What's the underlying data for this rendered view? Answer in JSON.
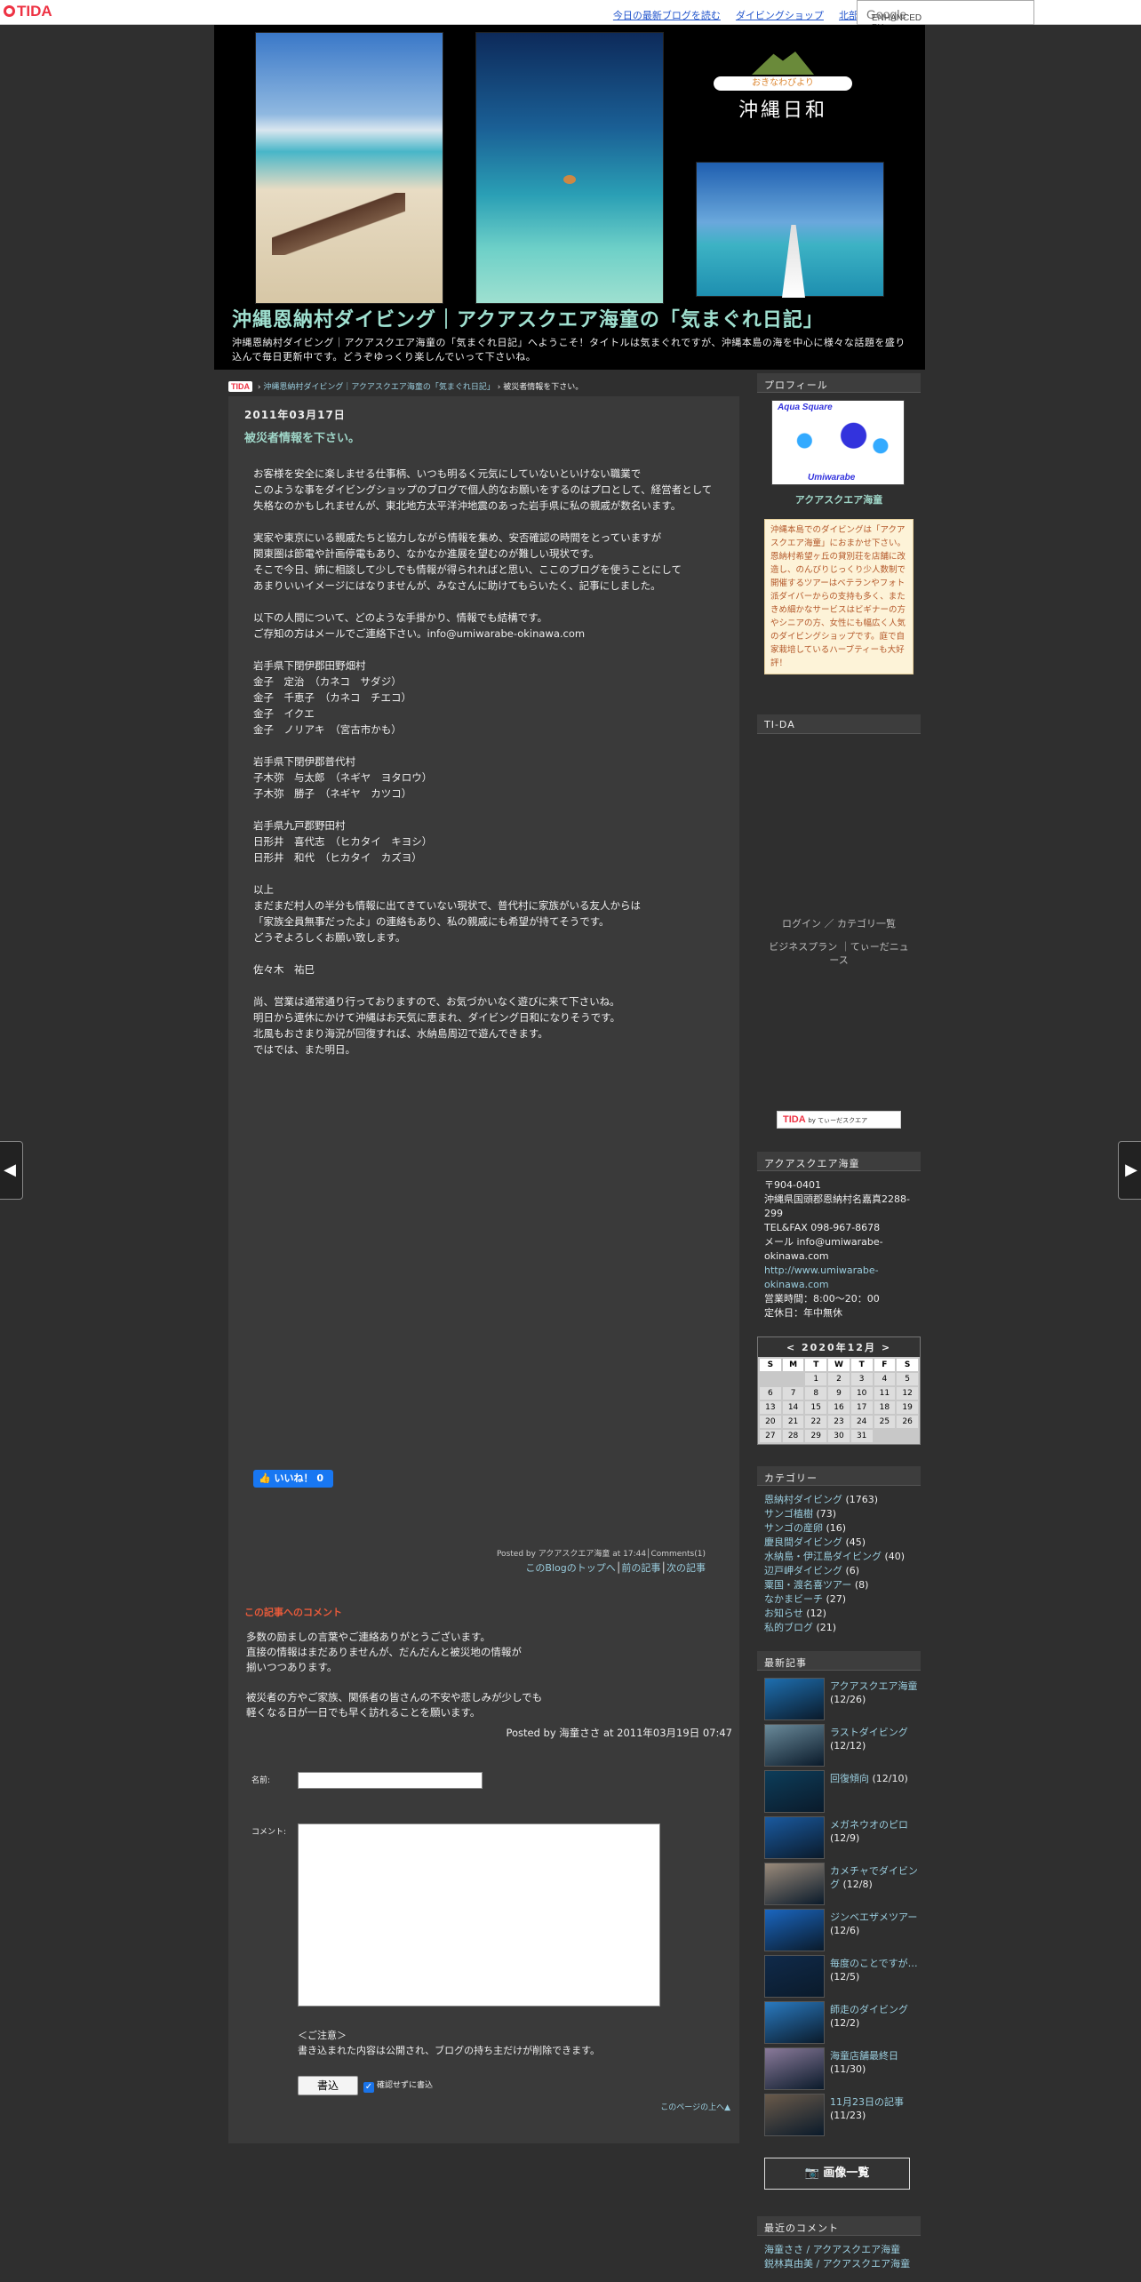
{
  "topbar": {
    "logo": "TIDA",
    "links": [
      "今日の最新ブログを読む",
      "ダイビングショップ",
      "北部"
    ],
    "search_label": "ENHANCED BY",
    "search_brand": "Google"
  },
  "header": {
    "logo_pill": "おきなわびより",
    "logo_name": "沖縄日和",
    "title": "沖縄恩納村ダイビング｜アクアスクエア海童の「気まぐれ日記」",
    "description": "沖縄恩納村ダイビング｜アクアスクエア海童の「気まぐれ日記」へようこそ！タイトルは気まぐれですが、沖縄本島の海を中心に様々な話題を盛り込んで毎日更新中です。どうぞゆっくり楽しんでいって下さいね。"
  },
  "breadcrumb": {
    "logo": "TIDA",
    "sep1": "›",
    "blog": "沖縄恩納村ダイビング｜アクアスクエア海童の「気まぐれ日記」",
    "sep2": "›",
    "current": "被災者情報を下さい。"
  },
  "post": {
    "date": "2011年03月17日",
    "title": "被災者情報を下さい。",
    "lines": [
      "お客様を安全に楽しませる仕事柄、いつも明るく元気にしていないといけない職業で",
      "このような事をダイビングショップのブログで個人的なお願いをするのはプロとして、経営者として",
      "失格なのかもしれませんが、東北地方太平洋沖地震のあった岩手県に私の親戚が数名います。",
      "",
      "実家や東京にいる親戚たちと協力しながら情報を集め、安否確認の時間をとっていますが",
      "関東圏は節電や計画停電もあり、なかなか進展を望むのが難しい現状です。",
      "そこで今日、姉に相談して少しでも情報が得られればと思い、ここのブログを使うことにして",
      "あまりいいイメージにはなりませんが、みなさんに助けてもらいたく、記事にしました。",
      "",
      "以下の人間について、どのような手掛かり、情報でも結構です。",
      "ご存知の方はメールでご連絡下さい。info@umiwarabe-okinawa.com",
      "",
      "岩手県下閉伊郡田野畑村",
      "金子　定治　（カネコ　サダジ）",
      "金子　千恵子　（カネコ　チエコ）",
      "金子　イクエ",
      "金子　ノリアキ　（宮古市かも）",
      "",
      "岩手県下閉伊郡普代村",
      "子木弥　与太郎　（ネギヤ　ヨタロウ）",
      "子木弥　勝子　（ネギヤ　カツコ）",
      "",
      "岩手県九戸郡野田村",
      "日形井　喜代志　（ヒカタイ　キヨシ）",
      "日形井　和代　（ヒカタイ　カズヨ）",
      "",
      "以上",
      "まだまだ村人の半分も情報に出てきていない現状で、普代村に家族がいる友人からは",
      "「家族全員無事だったよ」の連絡もあり、私の親戚にも希望が持てそうです。",
      "どうぞよろしくお願い致します。",
      "",
      "佐々木　祐巳",
      "",
      "尚、営業は通常通り行っておりますので、お気づかいなく遊びに来て下さいね。",
      "明日から連休にかけて沖縄はお天気に恵まれ、ダイビング日和になりそうです。",
      "北風もおさまり海況が回復すれば、水納島周辺で遊んできます。",
      "ではでは、また明日。"
    ],
    "like_label": "いいね！ 0",
    "posted_by": "Posted by アクアスクエア海童 at 17:44│Comments(1)",
    "nav_top": "このBlogのトップへ",
    "nav_prev": "前の記事",
    "nav_next": "次の記事"
  },
  "comments": {
    "heading": "この記事へのコメント",
    "lines": [
      "多数の励ましの言葉やご連絡ありがとうございます。",
      "直接の情報はまだありませんが、だんだんと被災地の情報が",
      "揃いつつあります。",
      "",
      "被災者の方やご家族、関係者の皆さんの不安や悲しみが少しでも",
      "軽くなる日が一日でも早く訪れることを願います。"
    ],
    "meta": "Posted by 海童ささ at 2011年03月19日 07:47",
    "name_label": "名前:",
    "comment_label": "コメント:",
    "notice_title": "＜ご注意＞",
    "notice_text": "書き込まれた内容は公開され、ブログの持ち主だけが削除できます。",
    "submit": "書込",
    "confirm_label": "確認せずに書込",
    "page_top": "このページの上へ▲"
  },
  "sidebar": {
    "profile_head": "プロフィール",
    "profile_logo_top": "Aqua Square",
    "profile_logo_bottom": "Umiwarabe",
    "profile_name": "アクアスクエア海童",
    "profile_text": "沖縄本島でのダイビングは「アクアスクエア海童」におまかせ下さい。恩納村希望ヶ丘の貸別荘を店舗に改造し、のんびりじっくり少人数制で開催するツアーはベテランやフォト派ダイバーからの支持も多く、またきめ細かなサービスはビギナーの方やシニアの方、女性にも幅広く人気のダイビングショップです。庭で自家栽培しているハーブティーも大好評！",
    "tida_head": "TI-DA",
    "tida_links": [
      "ログイン ／ カテゴリ一覧",
      "ビジネスプラン ｜てぃーだニュース"
    ],
    "tida_badge": "TIDA",
    "tida_badge_small": "by てぃーだスクエア",
    "shop_head": "アクアスクエア海童",
    "shop_lines": [
      "〒904-0401",
      "沖縄県国頭郡恩納村名嘉真2288-299",
      "TEL&FAX 098-967-8678",
      "メール info@umiwarabe-okinawa.com"
    ],
    "shop_url": "http://www.umiwarabe-okinawa.com",
    "shop_lines2": [
      "営業時間：8:00～20：00",
      "定休日：年中無休"
    ],
    "calendar": {
      "prev": "<",
      "title": "2020年12月",
      "next": ">",
      "weekdays": [
        "S",
        "M",
        "T",
        "W",
        "T",
        "F",
        "S"
      ],
      "weeks": [
        [
          "",
          "",
          "1",
          "2",
          "3",
          "4",
          "5"
        ],
        [
          "6",
          "7",
          "8",
          "9",
          "10",
          "11",
          "12"
        ],
        [
          "13",
          "14",
          "15",
          "16",
          "17",
          "18",
          "19"
        ],
        [
          "20",
          "21",
          "22",
          "23",
          "24",
          "25",
          "26"
        ],
        [
          "27",
          "28",
          "29",
          "30",
          "31",
          "",
          ""
        ]
      ]
    },
    "category_head": "カテゴリー",
    "categories": [
      {
        "name": "恩納村ダイビング",
        "count": "(1763)"
      },
      {
        "name": "サンゴ植樹",
        "count": "(73)"
      },
      {
        "name": "サンゴの産卵",
        "count": "(16)"
      },
      {
        "name": "慶良間ダイビング",
        "count": "(45)"
      },
      {
        "name": "水納島・伊江島ダイビング",
        "count": "(40)"
      },
      {
        "name": "辺戸岬ダイビング",
        "count": "(6)"
      },
      {
        "name": "粟国・渡名喜ツアー",
        "count": "(8)"
      },
      {
        "name": "なかまビーチ",
        "count": "(27)"
      },
      {
        "name": "お知らせ",
        "count": "(12)"
      },
      {
        "name": "私的ブログ",
        "count": "(21)"
      }
    ],
    "recent_head": "最新記事",
    "recent": [
      {
        "title": "アクアスクエア海童",
        "date": "(12/26)",
        "color": "#1e6fb0"
      },
      {
        "title": "ラストダイビング",
        "date": "(12/12)",
        "color": "#6a8a9a"
      },
      {
        "title": "回復傾向",
        "date": "(12/10)",
        "color": "#0d3d5a"
      },
      {
        "title": "メガネウオのピロ",
        "date": "(12/9)",
        "color": "#1a5aa0"
      },
      {
        "title": "カメチャでダイビング",
        "date": "(12/8)",
        "color": "#9a8a7a"
      },
      {
        "title": "ジンベエザメツアー",
        "date": "(12/6)",
        "color": "#1a66c0"
      },
      {
        "title": "毎度のことですが…",
        "date": "(12/5)",
        "color": "#102a4a"
      },
      {
        "title": "師走のダイビング",
        "date": "(12/2)",
        "color": "#2a7ac0"
      },
      {
        "title": "海童店舗最終日",
        "date": "(11/30)",
        "color": "#8a7a9a"
      },
      {
        "title": "11月23日の記事",
        "date": "(11/23)",
        "color": "#6a5a4a"
      }
    ],
    "gallery_label": "📷 画像一覧",
    "recent_comments_head": "最近のコメント",
    "recent_comments": [
      "海童ささ / アクアスクエア海童",
      "鋭林真由美 / アクアスクエア海童"
    ]
  },
  "nav_arrows": {
    "left": "◀",
    "right": "▶"
  }
}
